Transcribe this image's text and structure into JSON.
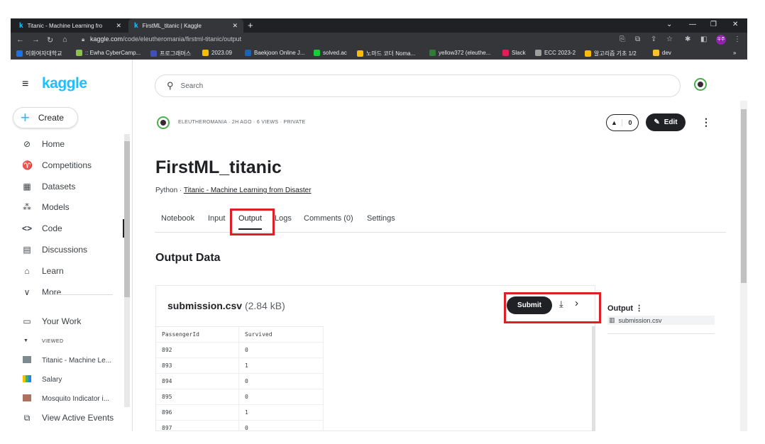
{
  "browser": {
    "tabs": [
      {
        "title": "Titanic - Machine Learning fro",
        "active": false
      },
      {
        "title": "FirstML_titanic | Kaggle",
        "active": true
      }
    ],
    "url_host": "kaggle.com",
    "url_path": "/code/eleutheromania/firstml-titanic/output",
    "profile_label": "우주",
    "bookmarks": [
      {
        "label": "이화여자대학교",
        "color": "#1a73e8"
      },
      {
        "label": ":: Ewha CyberCamp...",
        "color": "#8bc34a"
      },
      {
        "label": "프로그래머스",
        "color": "#3f51b5"
      },
      {
        "label": "2023.09",
        "color": "#fbbc04"
      },
      {
        "label": "Baekjoon Online J...",
        "color": "#1565c0"
      },
      {
        "label": "solved.ac",
        "color": "#17ce3a"
      },
      {
        "label": "노마드 코더 Noma...",
        "color": "#fbbc04"
      },
      {
        "label": "yellow372 (eleuthe...",
        "color": "#2e7d32"
      },
      {
        "label": "Slack",
        "color": "#e01e5a"
      },
      {
        "label": "ECC 2023-2",
        "color": "#9e9e9e"
      },
      {
        "label": "알고리즘 기초 1/2",
        "color": "#fbbc04"
      },
      {
        "label": "dev",
        "color": "#fbc02d"
      }
    ]
  },
  "sidebar": {
    "logo": "kaggle",
    "create_label": "Create",
    "items": [
      {
        "label": "Home",
        "icon": "compass-icon",
        "glyph": "⊘"
      },
      {
        "label": "Competitions",
        "icon": "trophy-icon",
        "glyph": "♈"
      },
      {
        "label": "Datasets",
        "icon": "table-icon",
        "glyph": "▦"
      },
      {
        "label": "Models",
        "icon": "models-icon",
        "glyph": "⁂"
      },
      {
        "label": "Code",
        "icon": "code-icon",
        "glyph": "<>"
      },
      {
        "label": "Discussions",
        "icon": "discussion-icon",
        "glyph": "▤"
      },
      {
        "label": "Learn",
        "icon": "graduation-cap-icon",
        "glyph": "⌂"
      },
      {
        "label": "More",
        "icon": "chevron-down-icon",
        "glyph": "∨"
      }
    ],
    "your_work": "Your Work",
    "viewed_header": "VIEWED",
    "viewed_items": [
      {
        "label": "Titanic - Machine Le...",
        "color": "#7d8a8f"
      },
      {
        "label": "Salary",
        "color": "#fbbc04"
      },
      {
        "label": "Mosquito Indicator i...",
        "color": "#b07060"
      }
    ],
    "view_active_events": "View Active Events"
  },
  "search": {
    "placeholder": "Search"
  },
  "notebook": {
    "meta": "ELEUTHEROMANIA · 2H AGO · 6 VIEWS · PRIVATE",
    "vote_count": "0",
    "edit_label": "Edit",
    "title": "FirstML_titanic",
    "language": "Python · ",
    "competition_link": "Titanic - Machine Learning from Disaster",
    "tabs": [
      "Notebook",
      "Input",
      "Output",
      "Logs",
      "Comments (0)",
      "Settings"
    ],
    "active_tab": "Output"
  },
  "output": {
    "heading": "Output Data",
    "file_name": "submission.csv",
    "file_size": "(2.84 kB)",
    "submit_label": "Submit",
    "columns": [
      "PassengerId",
      "Survived"
    ],
    "rows": [
      [
        "892",
        "0"
      ],
      [
        "893",
        "1"
      ],
      [
        "894",
        "0"
      ],
      [
        "895",
        "0"
      ],
      [
        "896",
        "1"
      ],
      [
        "897",
        "0"
      ]
    ],
    "side_heading": "Output",
    "side_file": "submission.csv"
  },
  "colors": {
    "accent": "#20beff",
    "highlight": "#e01e26",
    "dark": "#202124"
  }
}
